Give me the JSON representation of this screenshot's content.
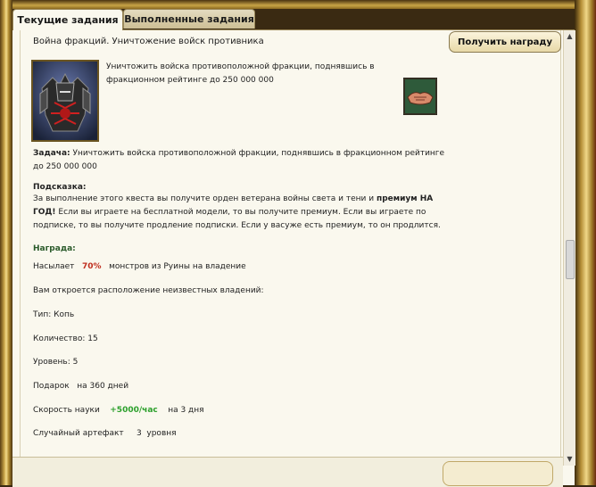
{
  "tabs": {
    "current": "Текущие задания",
    "completed": "Выполненные задания"
  },
  "quest": {
    "title": "Война фракций. Уничтожение войск противника",
    "claim_reward_label": "Получить награду",
    "description": "Уничтожить войска противоположной фракции, поднявшись в фракционном рейтинге до 250 000 000",
    "task_label": "Задача:",
    "task_text": "Уничтожить войска противоположной фракции, поднявшись в фракционном рейтинге до 250 000 000",
    "hint_label": "Подсказка:",
    "hint_text_1": "За выполнение этого квеста вы получите орден ветерана войны света и тени и ",
    "hint_bold": "премиум НА ГОД!",
    "hint_text_2": " Если вы играете на бесплатной модели, то вы получите премиум. Если вы играете по подписке, то вы получите продление подписки. Если у васуже есть премиум, то он продлится.",
    "reward_label": "Награда:",
    "reward_populates_prefix": "Насылает",
    "reward_populates_percent": "70%",
    "reward_populates_suffix": "монстров из Руины на владение",
    "reward_lands": "Вам откроется расположение неизвестных владений:",
    "reward_type": "Тип: Копь",
    "reward_amount": "Количество: 15",
    "reward_level": "Уровень: 5",
    "reward_gift": "Подарок   на 360 дней",
    "reward_science_prefix": "Скорость науки",
    "reward_science_value": "+5000/час",
    "reward_science_suffix": "на 3 дня",
    "reward_artifact": "Случайный артефакт     3  уровня"
  }
}
